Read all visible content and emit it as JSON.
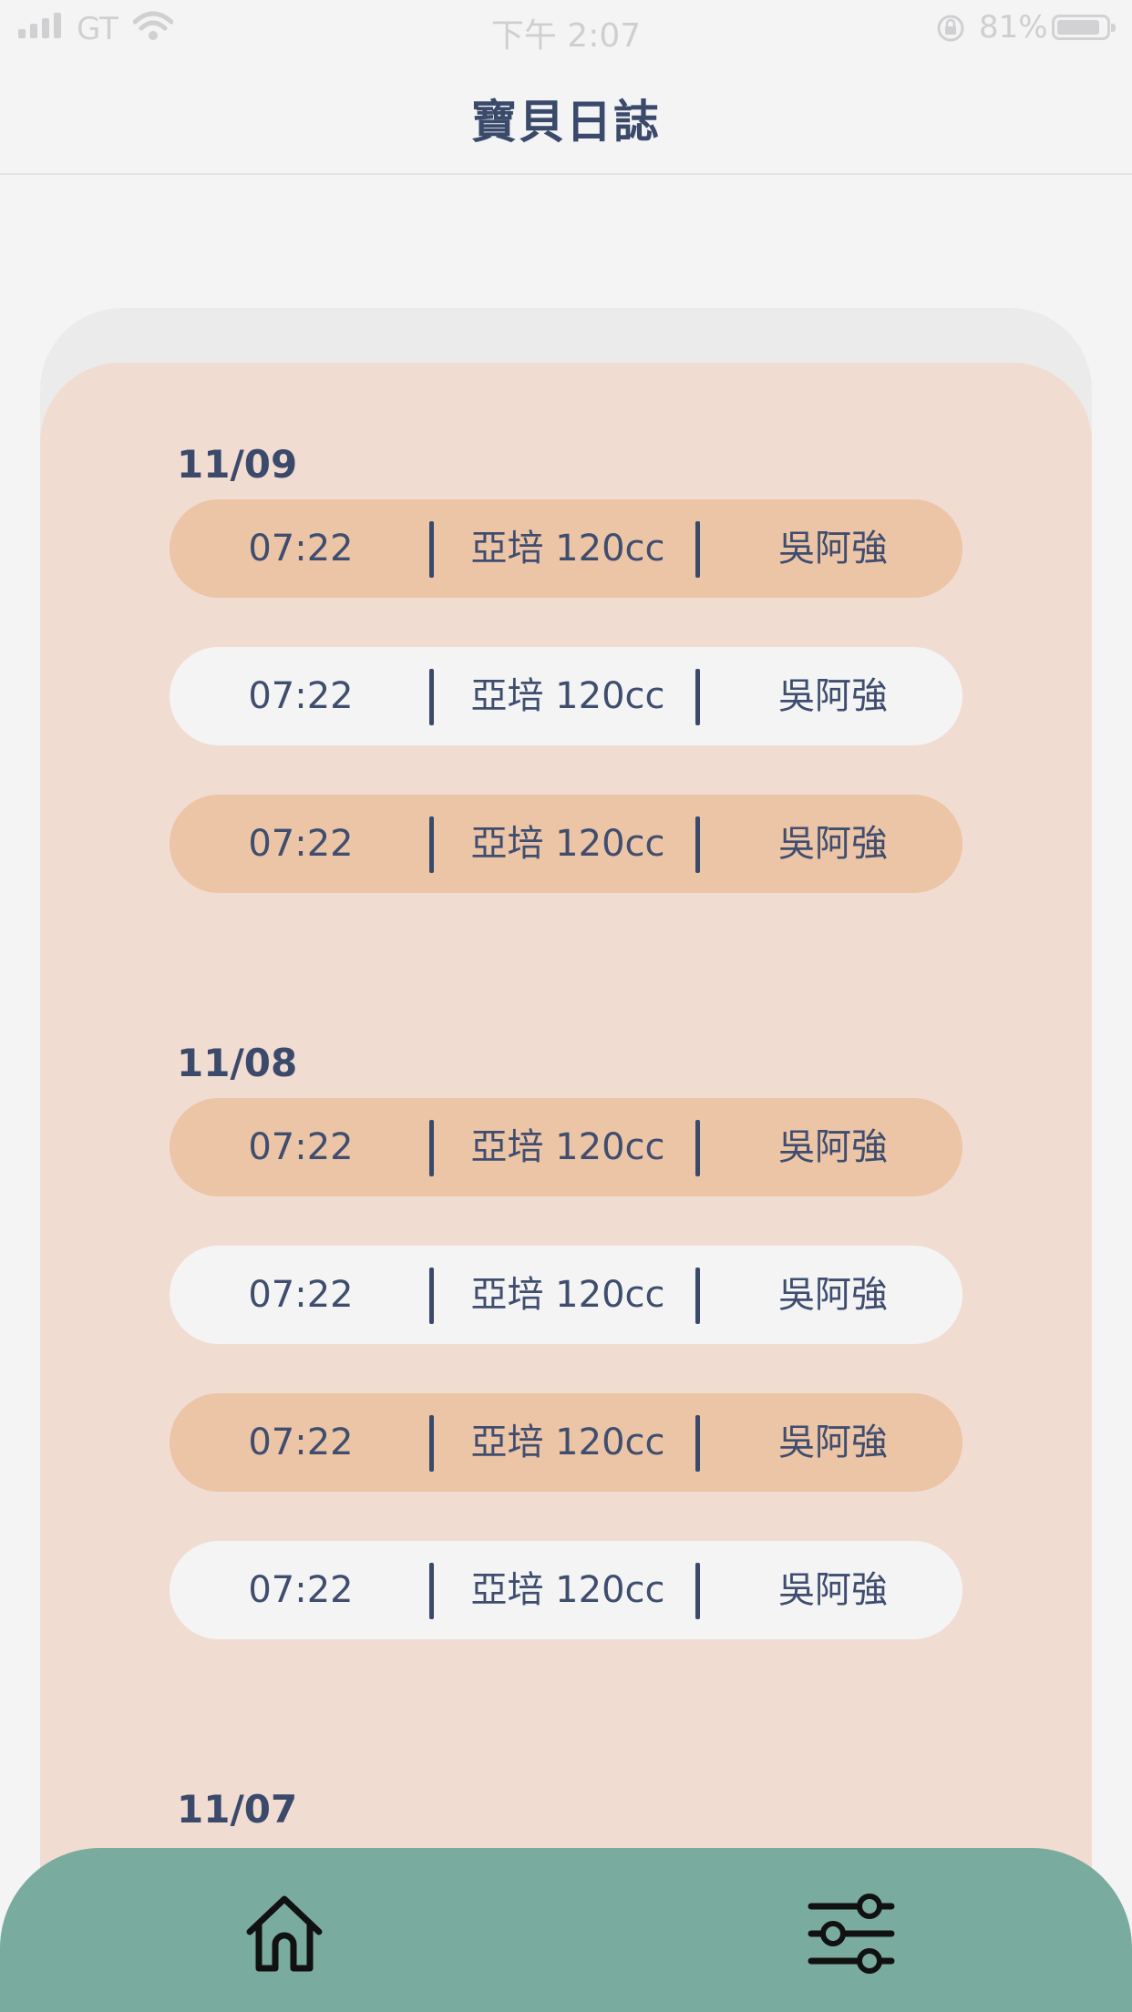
{
  "status_bar": {
    "carrier": "GT",
    "time": "下午 2:07",
    "battery": "81%"
  },
  "header": {
    "title": "寶貝日誌"
  },
  "days": [
    {
      "date": "11/09",
      "entries": [
        {
          "time": "07:22",
          "feed": "亞培 120cc",
          "name": "吳阿強",
          "style": "peach"
        },
        {
          "time": "07:22",
          "feed": "亞培 120cc",
          "name": "吳阿強",
          "style": "light"
        },
        {
          "time": "07:22",
          "feed": "亞培 120cc",
          "name": "吳阿強",
          "style": "peach"
        }
      ]
    },
    {
      "date": "11/08",
      "entries": [
        {
          "time": "07:22",
          "feed": "亞培 120cc",
          "name": "吳阿強",
          "style": "peach"
        },
        {
          "time": "07:22",
          "feed": "亞培 120cc",
          "name": "吳阿強",
          "style": "light"
        },
        {
          "time": "07:22",
          "feed": "亞培 120cc",
          "name": "吳阿強",
          "style": "peach"
        },
        {
          "time": "07:22",
          "feed": "亞培 120cc",
          "name": "吳阿強",
          "style": "light"
        }
      ]
    },
    {
      "date": "11/07",
      "entries": []
    }
  ],
  "nav": {
    "home_icon": "home-icon",
    "settings_icon": "sliders-icon"
  },
  "colors": {
    "accent_peach": "#ecc4a6",
    "card_bg": "#f1dcd2",
    "nav_green": "#7aab9f",
    "text_navy": "#3b4a6b"
  }
}
